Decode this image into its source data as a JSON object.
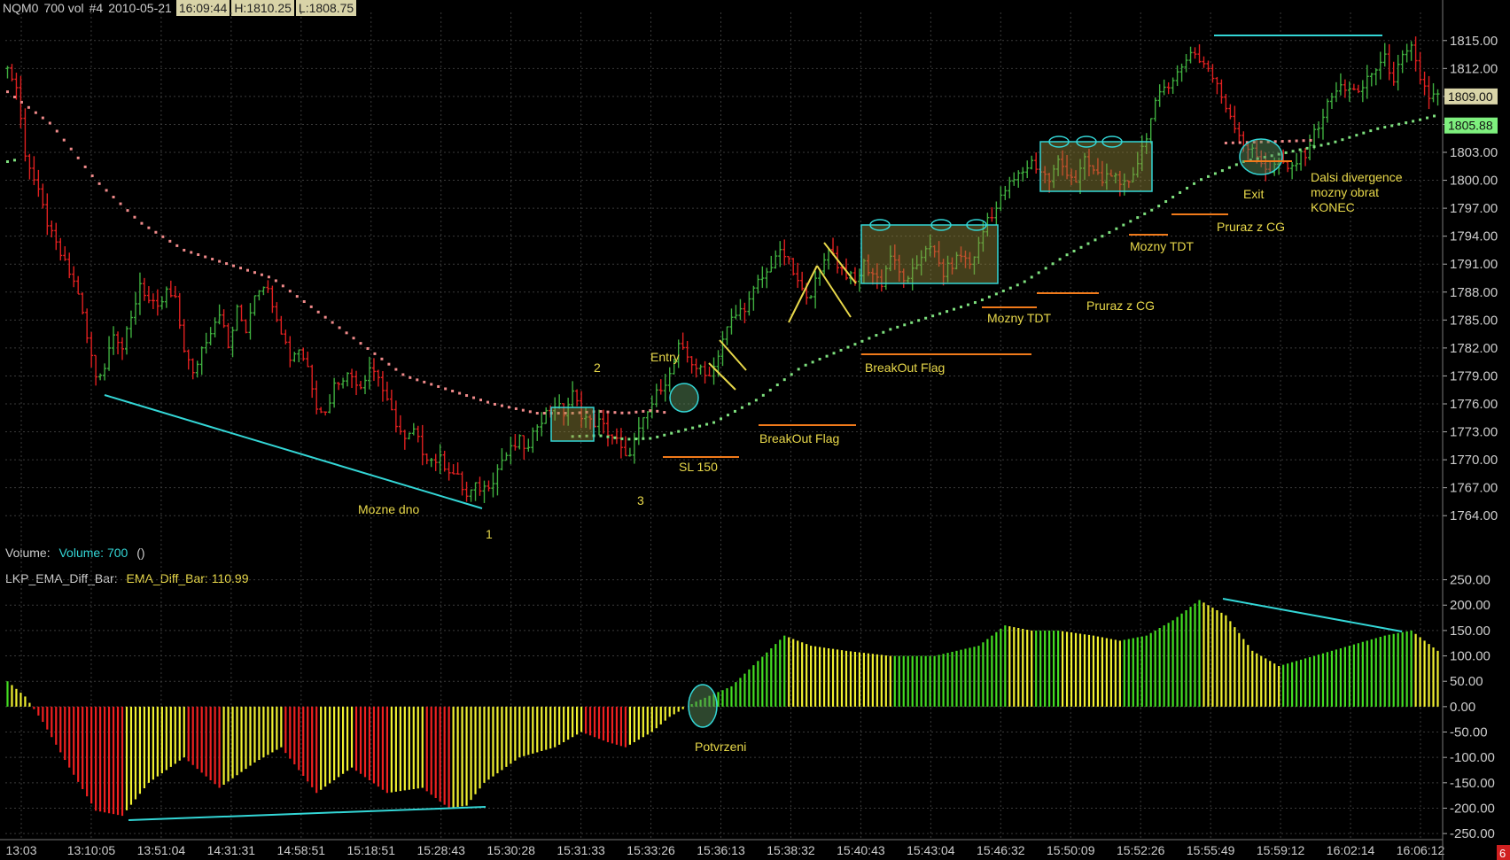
{
  "header": {
    "symbol": "NQM0",
    "bar_spec": "700 vol",
    "chart_no": "#4",
    "date": "2010-05-21",
    "time": "16:09:44",
    "high": "H:1810.25",
    "low": "L:1808.75"
  },
  "volume_label": {
    "prefix": "Volume:",
    "value": "Volume: 700",
    "suffix": "()"
  },
  "indicator_label": {
    "prefix": "LKP_EMA_Diff_Bar:",
    "value": "EMA_Diff_Bar: 110.99"
  },
  "colors": {
    "up": "#3fae3f",
    "down": "#e02020",
    "grid": "#3a3a3a",
    "cyan": "#33d6d6",
    "yellow_text": "#e8d84a",
    "orange": "#f07a1a",
    "ema_slow": "#f08a8a",
    "ema_fast": "#7ee07e",
    "osc_green": "#44dd22",
    "osc_yellow": "#f0f030",
    "osc_red": "#ee2020",
    "last_box": "#d9d4a8",
    "ema_box": "#7ef07e"
  },
  "chart_data": [
    {
      "type": "candlestick",
      "ylim": [
        1762.5,
        1816.5
      ],
      "y_ticks": [
        "1815.00",
        "1812.00",
        "1809.00",
        "1806.00",
        "1803.00",
        "1800.00",
        "1797.00",
        "1794.00",
        "1791.00",
        "1788.00",
        "1785.00",
        "1782.00",
        "1779.00",
        "1776.00",
        "1773.00",
        "1770.00",
        "1767.00",
        "1764.00"
      ],
      "x_ticks": [
        "13:03",
        "13:10:05",
        "13:51:04",
        "14:31:31",
        "14:58:51",
        "15:18:51",
        "15:28:43",
        "15:30:28",
        "15:31:33",
        "15:33:26",
        "15:36:13",
        "15:38:32",
        "15:40:43",
        "15:43:04",
        "15:46:32",
        "15:50:09",
        "15:52:26",
        "15:55:49",
        "15:59:12",
        "16:02:14",
        "16:06:12"
      ],
      "price_path": [
        [
          0,
          1812
        ],
        [
          2,
          1810
        ],
        [
          4,
          1803
        ],
        [
          6,
          1800
        ],
        [
          8,
          1797
        ],
        [
          10,
          1794
        ],
        [
          12,
          1792
        ],
        [
          14,
          1790
        ],
        [
          16,
          1788
        ],
        [
          18,
          1783
        ],
        [
          20,
          1779
        ],
        [
          22,
          1780
        ],
        [
          24,
          1784
        ],
        [
          26,
          1782
        ],
        [
          28,
          1785
        ],
        [
          30,
          1789
        ],
        [
          32,
          1787
        ],
        [
          34,
          1786
        ],
        [
          36,
          1788
        ],
        [
          38,
          1787
        ],
        [
          40,
          1782
        ],
        [
          42,
          1779
        ],
        [
          44,
          1782
        ],
        [
          46,
          1784
        ],
        [
          48,
          1786
        ],
        [
          50,
          1782
        ],
        [
          52,
          1786
        ],
        [
          54,
          1784
        ],
        [
          56,
          1788
        ],
        [
          58,
          1789
        ],
        [
          60,
          1787
        ],
        [
          62,
          1784
        ],
        [
          64,
          1781
        ],
        [
          66,
          1782
        ],
        [
          68,
          1780
        ],
        [
          70,
          1776
        ],
        [
          72,
          1775
        ],
        [
          74,
          1778
        ],
        [
          76,
          1779
        ],
        [
          78,
          1779
        ],
        [
          80,
          1778
        ],
        [
          82,
          1780
        ],
        [
          84,
          1779
        ],
        [
          86,
          1776
        ],
        [
          88,
          1774
        ],
        [
          90,
          1772
        ],
        [
          92,
          1773
        ],
        [
          94,
          1771
        ],
        [
          96,
          1770
        ],
        [
          98,
          1770
        ],
        [
          100,
          1769
        ],
        [
          102,
          1768
        ],
        [
          104,
          1766
        ],
        [
          106,
          1767
        ],
        [
          108,
          1767
        ],
        [
          110,
          1768
        ],
        [
          112,
          1770
        ],
        [
          114,
          1771
        ],
        [
          116,
          1772
        ],
        [
          118,
          1771
        ],
        [
          120,
          1774
        ],
        [
          122,
          1775
        ],
        [
          124,
          1776
        ],
        [
          126,
          1775
        ],
        [
          128,
          1777
        ],
        [
          130,
          1775
        ],
        [
          132,
          1774
        ],
        [
          134,
          1774
        ],
        [
          136,
          1773
        ],
        [
          138,
          1772
        ],
        [
          140,
          1770
        ],
        [
          142,
          1772
        ],
        [
          144,
          1774
        ],
        [
          146,
          1776
        ],
        [
          148,
          1778
        ],
        [
          150,
          1779
        ],
        [
          152,
          1782
        ],
        [
          154,
          1781
        ],
        [
          156,
          1780
        ],
        [
          158,
          1779
        ],
        [
          160,
          1780
        ],
        [
          162,
          1783
        ],
        [
          164,
          1785
        ],
        [
          166,
          1786
        ],
        [
          168,
          1787
        ],
        [
          170,
          1789
        ],
        [
          172,
          1790
        ],
        [
          174,
          1792
        ],
        [
          176,
          1792
        ],
        [
          178,
          1790
        ],
        [
          180,
          1788
        ],
        [
          182,
          1788
        ],
        [
          184,
          1790
        ],
        [
          186,
          1793
        ],
        [
          188,
          1791
        ],
        [
          190,
          1790
        ],
        [
          192,
          1789
        ],
        [
          194,
          1791
        ],
        [
          196,
          1790
        ],
        [
          198,
          1789
        ],
        [
          200,
          1792
        ],
        [
          202,
          1790
        ],
        [
          204,
          1789
        ],
        [
          206,
          1791
        ],
        [
          208,
          1793
        ],
        [
          210,
          1792
        ],
        [
          212,
          1790
        ],
        [
          214,
          1791
        ],
        [
          216,
          1792
        ],
        [
          218,
          1791
        ],
        [
          220,
          1793
        ],
        [
          222,
          1796
        ],
        [
          224,
          1797
        ],
        [
          226,
          1799
        ],
        [
          228,
          1800
        ],
        [
          230,
          1801
        ],
        [
          232,
          1802
        ],
        [
          234,
          1801
        ],
        [
          236,
          1800
        ],
        [
          238,
          1802
        ],
        [
          240,
          1801
        ],
        [
          242,
          1800
        ],
        [
          244,
          1802
        ],
        [
          246,
          1801
        ],
        [
          248,
          1800
        ],
        [
          250,
          1801
        ],
        [
          252,
          1799
        ],
        [
          254,
          1800
        ],
        [
          256,
          1802
        ],
        [
          258,
          1805
        ],
        [
          260,
          1808
        ],
        [
          262,
          1810
        ],
        [
          264,
          1811
        ],
        [
          266,
          1812
        ],
        [
          268,
          1814
        ],
        [
          270,
          1813
        ],
        [
          272,
          1812
        ],
        [
          274,
          1810
        ],
        [
          276,
          1808
        ],
        [
          278,
          1806
        ],
        [
          280,
          1804
        ],
        [
          282,
          1803
        ],
        [
          284,
          1802
        ],
        [
          286,
          1801
        ],
        [
          288,
          1802
        ],
        [
          290,
          1801
        ],
        [
          292,
          1802
        ],
        [
          294,
          1803
        ],
        [
          296,
          1805
        ],
        [
          298,
          1807
        ],
        [
          300,
          1809
        ],
        [
          302,
          1810
        ],
        [
          304,
          1810
        ],
        [
          306,
          1809
        ],
        [
          308,
          1811
        ],
        [
          310,
          1812
        ],
        [
          312,
          1813
        ],
        [
          314,
          1811
        ],
        [
          316,
          1813
        ],
        [
          318,
          1814
        ],
        [
          320,
          1811
        ],
        [
          322,
          1809
        ],
        [
          324,
          1809
        ]
      ],
      "ema_slow": [
        [
          0,
          1809.5
        ],
        [
          10,
          1806
        ],
        [
          20,
          1800
        ],
        [
          30,
          1795.5
        ],
        [
          40,
          1792.5
        ],
        [
          50,
          1791
        ],
        [
          60,
          1789.5
        ],
        [
          70,
          1786
        ],
        [
          80,
          1782.5
        ],
        [
          90,
          1779
        ],
        [
          100,
          1777.5
        ],
        [
          110,
          1776
        ],
        [
          120,
          1775
        ],
        [
          128,
          1775
        ],
        [
          134,
          1775.2
        ],
        [
          140,
          1775
        ],
        [
          146,
          1775.3
        ],
        [
          150,
          1775
        ]
      ],
      "ema_fast": [
        [
          0,
          1802
        ],
        [
          2,
          1802.2
        ]
      ],
      "ema_fast_main": [
        [
          128,
          1772.5
        ],
        [
          134,
          1772.6
        ],
        [
          140,
          1772.2
        ],
        [
          146,
          1772.3
        ],
        [
          150,
          1772.8
        ],
        [
          160,
          1774
        ],
        [
          170,
          1776.5
        ],
        [
          180,
          1780
        ],
        [
          190,
          1782
        ],
        [
          200,
          1784
        ],
        [
          210,
          1785.5
        ],
        [
          220,
          1787
        ],
        [
          230,
          1789
        ],
        [
          240,
          1792
        ],
        [
          250,
          1794.5
        ],
        [
          260,
          1797
        ],
        [
          270,
          1800
        ],
        [
          280,
          1802
        ],
        [
          290,
          1803
        ],
        [
          300,
          1804
        ],
        [
          310,
          1805.5
        ],
        [
          320,
          1806.5
        ],
        [
          324,
          1807
        ]
      ],
      "ema_slow_late": [
        [
          276,
          1804
        ],
        [
          290,
          1804.2
        ],
        [
          296,
          1804.3
        ]
      ],
      "last_price": "1809.00",
      "ema_value": "1805.88"
    },
    {
      "type": "bar",
      "name": "EMA_Diff_Bar",
      "ylim": [
        -255,
        258
      ],
      "y_ticks": [
        "250.00",
        "200.00",
        "150.00",
        "100.00",
        "50.00",
        "0.00",
        "-50.00",
        "-100.00",
        "-150.00",
        "-200.00",
        "-250.00"
      ],
      "osc_path": [
        [
          0,
          50
        ],
        [
          4,
          20
        ],
        [
          8,
          -30
        ],
        [
          14,
          -120
        ],
        [
          20,
          -205
        ],
        [
          26,
          -215
        ],
        [
          32,
          -150
        ],
        [
          40,
          -100
        ],
        [
          48,
          -160
        ],
        [
          56,
          -110
        ],
        [
          62,
          -80
        ],
        [
          70,
          -170
        ],
        [
          78,
          -120
        ],
        [
          86,
          -170
        ],
        [
          94,
          -160
        ],
        [
          100,
          -200
        ],
        [
          104,
          -195
        ],
        [
          108,
          -150
        ],
        [
          116,
          -100
        ],
        [
          124,
          -80
        ],
        [
          130,
          -50
        ],
        [
          136,
          -70
        ],
        [
          140,
          -80
        ],
        [
          146,
          -50
        ],
        [
          150,
          -20
        ],
        [
          156,
          10
        ],
        [
          164,
          40
        ],
        [
          170,
          90
        ],
        [
          176,
          140
        ],
        [
          182,
          120
        ],
        [
          190,
          110
        ],
        [
          200,
          100
        ],
        [
          210,
          100
        ],
        [
          220,
          120
        ],
        [
          226,
          160
        ],
        [
          232,
          150
        ],
        [
          238,
          150
        ],
        [
          246,
          140
        ],
        [
          252,
          130
        ],
        [
          258,
          140
        ],
        [
          264,
          170
        ],
        [
          270,
          210
        ],
        [
          276,
          180
        ],
        [
          282,
          110
        ],
        [
          288,
          80
        ],
        [
          296,
          100
        ],
        [
          304,
          120
        ],
        [
          312,
          140
        ],
        [
          318,
          150
        ],
        [
          324,
          110
        ]
      ]
    }
  ],
  "annotations": {
    "mozne_dno": "Mozne dno",
    "num1": "1",
    "num2": "2",
    "num3": "3",
    "entry": "Entry",
    "sl": "SL 150",
    "breakout1": "BreakOut Flag",
    "breakout2": "BreakOut Flag",
    "mozny_tdt1": "Mozny TDT",
    "pruraz1": "Pruraz z CG",
    "mozny_tdt2": "Mozny TDT",
    "pruraz2": "Pruraz z CG",
    "exit": "Exit",
    "dalsi1": "Dalsi divergence",
    "dalsi2": "mozny obrat",
    "dalsi3": "KONEC",
    "potvrzeni": "Potvrzeni",
    "corner_badge": "6"
  }
}
